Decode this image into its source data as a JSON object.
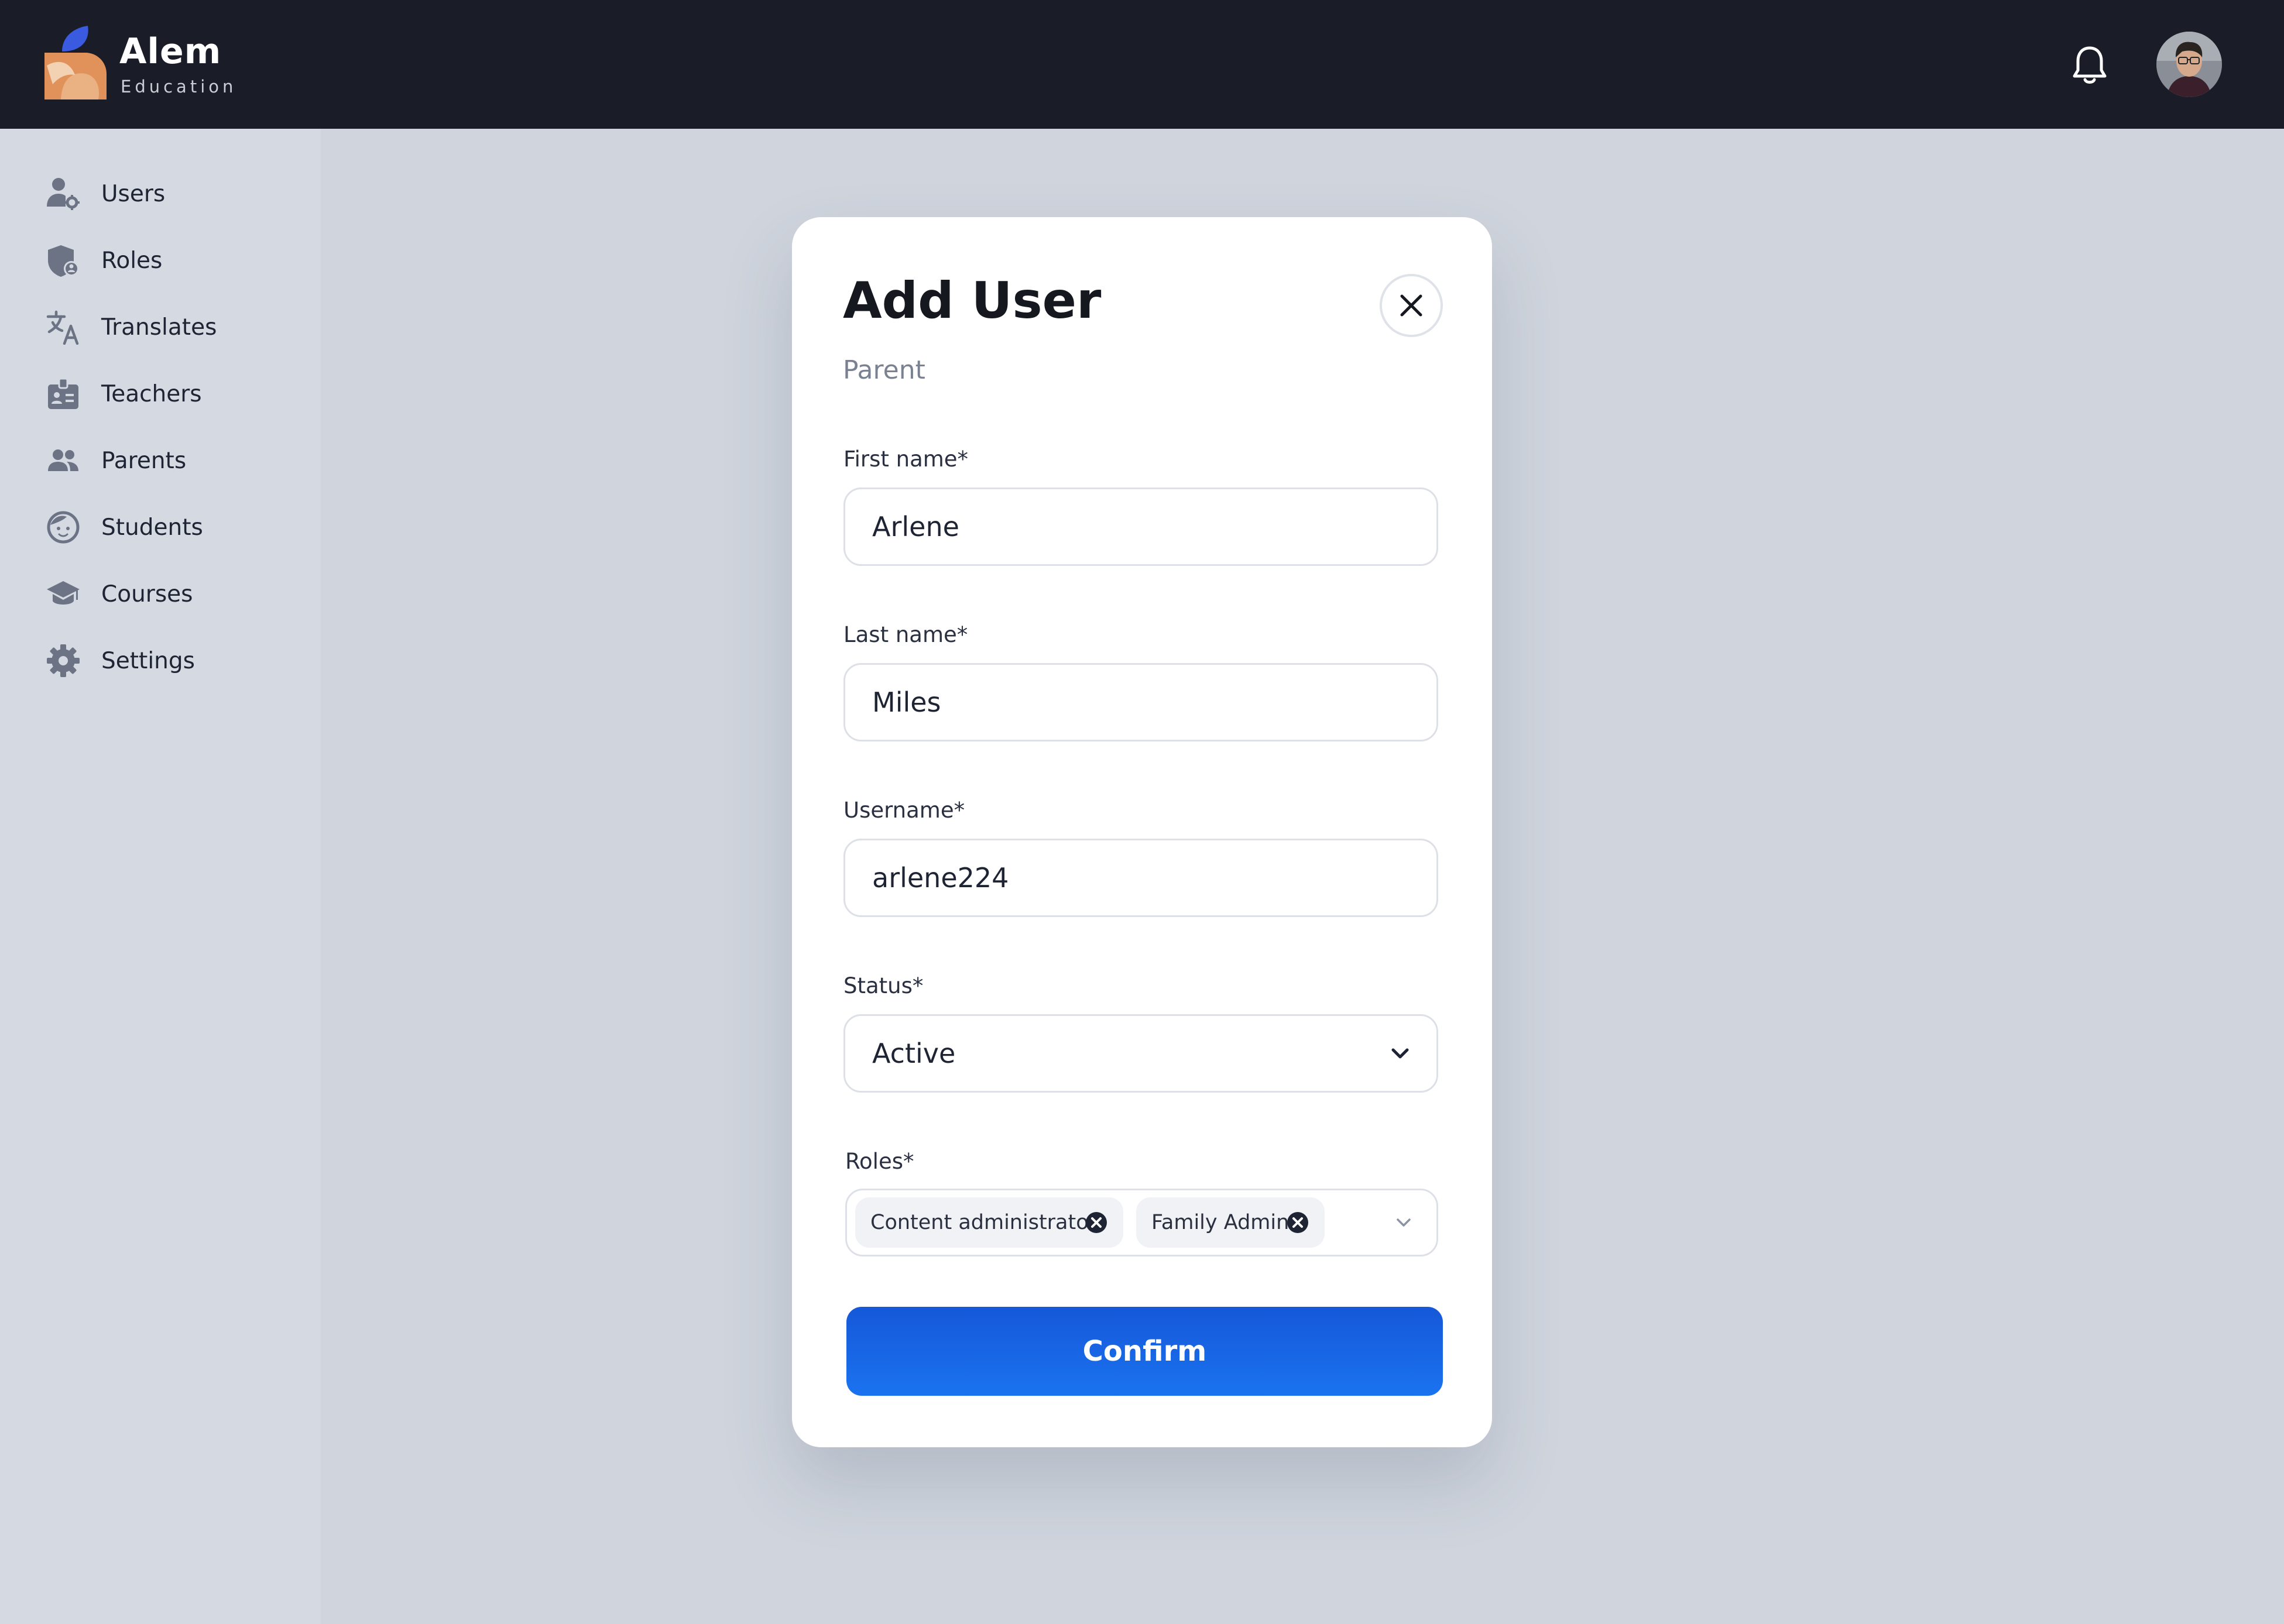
{
  "app": {
    "brand_name": "Alem",
    "brand_sub": "Education"
  },
  "header": {
    "notification_icon": "bell-icon",
    "avatar_icon": "user-avatar"
  },
  "sidebar": {
    "items": [
      {
        "label": "Users",
        "icon": "user-settings-icon"
      },
      {
        "label": "Roles",
        "icon": "shield-user-icon"
      },
      {
        "label": "Translates",
        "icon": "translate-icon"
      },
      {
        "label": "Teachers",
        "icon": "id-badge-icon"
      },
      {
        "label": "Parents",
        "icon": "people-icon"
      },
      {
        "label": "Students",
        "icon": "child-face-icon"
      },
      {
        "label": "Courses",
        "icon": "graduation-cap-icon"
      },
      {
        "label": "Settings",
        "icon": "gear-icon"
      }
    ]
  },
  "modal": {
    "title": "Add User",
    "subtitle": "Parent",
    "fields": {
      "first_name": {
        "label": "First name*",
        "value": "Arlene"
      },
      "last_name": {
        "label": "Last name*",
        "value": "Miles"
      },
      "username": {
        "label": "Username*",
        "value": "arlene224"
      },
      "status": {
        "label": "Status*",
        "value": "Active"
      },
      "roles": {
        "label": "Roles*",
        "tags": [
          "Content administrator",
          "Family Admin"
        ]
      }
    },
    "confirm_label": "Confirm"
  },
  "colors": {
    "topbar": "#1A1D27",
    "sidebar": "#D5D9E1",
    "background": "#CFD4DD",
    "primary": "#1B73F0",
    "icon": "#6B7385",
    "logo_orange": "#E1915A",
    "logo_blue": "#3A5BE0"
  }
}
